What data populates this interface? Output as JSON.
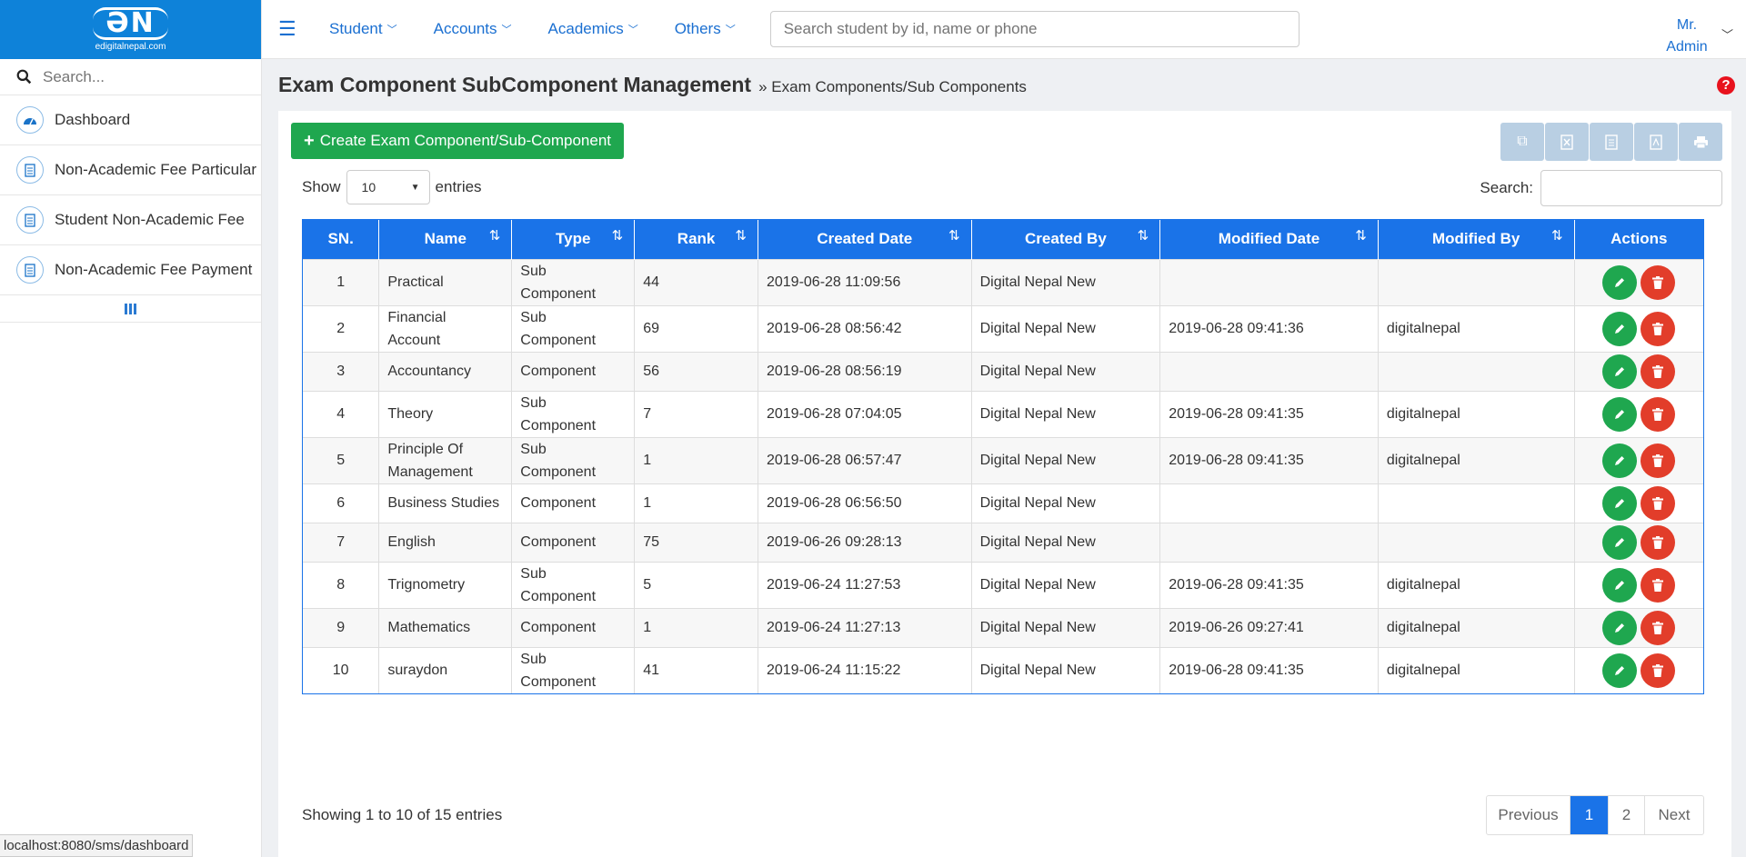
{
  "app": {
    "logo_mark": "ƏN",
    "logo_text": "edigitalnepal.com"
  },
  "sidebar": {
    "search_placeholder": "Search...",
    "items": [
      {
        "label": "Dashboard",
        "icon": "dashboard-icon"
      },
      {
        "label": "Non-Academic Fee Particular",
        "icon": "document-icon"
      },
      {
        "label": "Student Non-Academic Fee",
        "icon": "document-icon"
      },
      {
        "label": "Non-Academic Fee Payment",
        "icon": "document-icon"
      }
    ],
    "status_url": "localhost:8080/sms/dashboard"
  },
  "topnav": {
    "menu": [
      "Student",
      "Accounts",
      "Academics",
      "Others"
    ],
    "search_placeholder": "Search student by id, name or phone",
    "user_name": "Mr. Admin"
  },
  "page": {
    "title": "Exam Component SubComponent Management",
    "breadcrumb": "» Exam Components/Sub Components",
    "create_label": "Create Exam Component/Sub-Component",
    "show_label": "Show",
    "page_length": "10",
    "entries_label": "entries",
    "search_label": "Search:",
    "export_icons": [
      "copy-icon",
      "excel-icon",
      "csv-icon",
      "pdf-icon",
      "print-icon"
    ]
  },
  "table": {
    "headers": [
      "SN.",
      "Name",
      "Type",
      "Rank",
      "Created Date",
      "Created By",
      "Modified Date",
      "Modified By",
      "Actions"
    ],
    "rows": [
      {
        "sn": "1",
        "name": "Practical",
        "type": "Sub Component",
        "rank": "44",
        "created_date": "2019-06-28 11:09:56",
        "created_by": "Digital Nepal New",
        "modified_date": "",
        "modified_by": ""
      },
      {
        "sn": "2",
        "name": "Financial Account",
        "type": "Sub Component",
        "rank": "69",
        "created_date": "2019-06-28 08:56:42",
        "created_by": "Digital Nepal New",
        "modified_date": "2019-06-28 09:41:36",
        "modified_by": "digitalnepal"
      },
      {
        "sn": "3",
        "name": "Accountancy",
        "type": "Component",
        "rank": "56",
        "created_date": "2019-06-28 08:56:19",
        "created_by": "Digital Nepal New",
        "modified_date": "",
        "modified_by": ""
      },
      {
        "sn": "4",
        "name": "Theory",
        "type": "Sub Component",
        "rank": "7",
        "created_date": "2019-06-28 07:04:05",
        "created_by": "Digital Nepal New",
        "modified_date": "2019-06-28 09:41:35",
        "modified_by": "digitalnepal"
      },
      {
        "sn": "5",
        "name": "Principle Of Management",
        "type": "Sub Component",
        "rank": "1",
        "created_date": "2019-06-28 06:57:47",
        "created_by": "Digital Nepal New",
        "modified_date": "2019-06-28 09:41:35",
        "modified_by": "digitalnepal"
      },
      {
        "sn": "6",
        "name": "Business Studies",
        "type": "Component",
        "rank": "1",
        "created_date": "2019-06-28 06:56:50",
        "created_by": "Digital Nepal New",
        "modified_date": "",
        "modified_by": ""
      },
      {
        "sn": "7",
        "name": "English",
        "type": "Component",
        "rank": "75",
        "created_date": "2019-06-26 09:28:13",
        "created_by": "Digital Nepal New",
        "modified_date": "",
        "modified_by": ""
      },
      {
        "sn": "8",
        "name": "Trignometry",
        "type": "Sub Component",
        "rank": "5",
        "created_date": "2019-06-24 11:27:53",
        "created_by": "Digital Nepal New",
        "modified_date": "2019-06-28 09:41:35",
        "modified_by": "digitalnepal"
      },
      {
        "sn": "9",
        "name": "Mathematics",
        "type": "Component",
        "rank": "1",
        "created_date": "2019-06-24 11:27:13",
        "created_by": "Digital Nepal New",
        "modified_date": "2019-06-26 09:27:41",
        "modified_by": "digitalnepal"
      },
      {
        "sn": "10",
        "name": "suraydon",
        "type": "Sub Component",
        "rank": "41",
        "created_date": "2019-06-24 11:15:22",
        "created_by": "Digital Nepal New",
        "modified_date": "2019-06-28 09:41:35",
        "modified_by": "digitalnepal"
      }
    ]
  },
  "footer": {
    "info": "Showing 1 to 10 of 15 entries",
    "previous": "Previous",
    "pages": [
      "1",
      "2"
    ],
    "current_page": "1",
    "next": "Next"
  },
  "colors": {
    "brand_blue": "#0e82d9",
    "header_blue": "#1a73e8",
    "create_green": "#1fa74f",
    "delete_red": "#e23d2a"
  }
}
